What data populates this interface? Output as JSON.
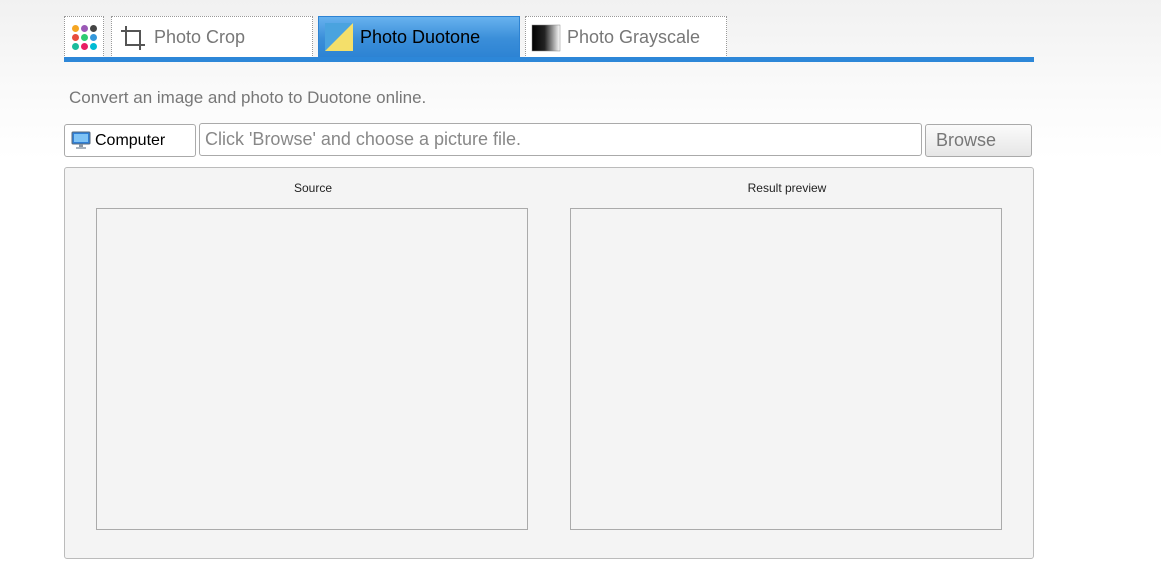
{
  "tabs": {
    "apps": {
      "icon": "apps-grid-icon",
      "dot_colors": [
        "#f5a623",
        "#9b59b6",
        "#444444",
        "#e74c3c",
        "#2ecc71",
        "#3498db",
        "#1abc9c",
        "#e91e63",
        "#00bcd4"
      ]
    },
    "crop": {
      "label": "Photo Crop",
      "icon": "crop-icon"
    },
    "duotone": {
      "label": "Photo Duotone",
      "icon": "duotone-icon",
      "active": true
    },
    "grayscale": {
      "label": "Photo Grayscale",
      "icon": "grayscale-gradient-icon"
    }
  },
  "accent_color": "#2d87d8",
  "intro_text": "Convert an image and photo to Duotone online.",
  "source_select": {
    "label": "Computer",
    "icon": "computer-monitor-icon"
  },
  "file_input": {
    "placeholder": "Click 'Browse' and choose a picture file.",
    "value": ""
  },
  "browse_label": "Browse",
  "panels": {
    "source_title": "Source",
    "result_title": "Result preview"
  }
}
